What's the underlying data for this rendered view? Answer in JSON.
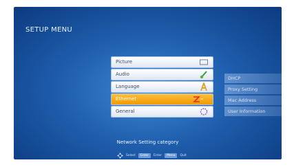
{
  "title": "SETUP MENU",
  "menu": [
    {
      "label": "Picture",
      "icon": "monitor-icon"
    },
    {
      "label": "Audio",
      "icon": "guitar-icon"
    },
    {
      "label": "Language",
      "icon": "letter-a-icon"
    },
    {
      "label": "Ethernet",
      "icon": "cable-icon",
      "selected": true
    },
    {
      "label": "General",
      "icon": "settings-circle-icon"
    }
  ],
  "submenu": [
    "DHCP",
    "Proxy Setting",
    "Mac Address",
    "User Information"
  ],
  "help": "Network Setting category",
  "hints": {
    "select": "Select",
    "enter_key": "Enter",
    "enter": "Enter",
    "menu_key": "Menu",
    "quit": "Quit"
  },
  "colors": {
    "background": "#1f5fae",
    "selected": "#f4a000"
  }
}
